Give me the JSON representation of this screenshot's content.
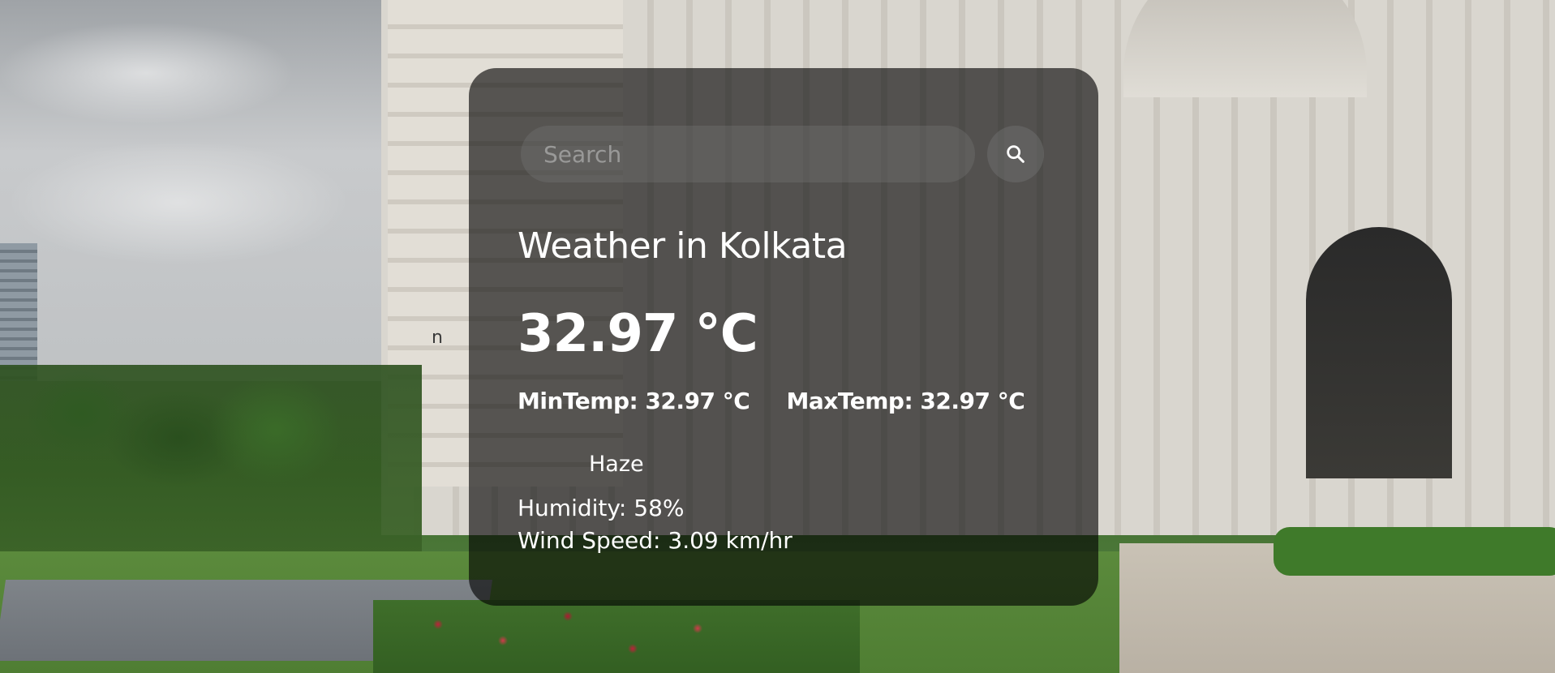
{
  "search": {
    "placeholder": "Search",
    "icon": "search-icon"
  },
  "weather": {
    "title": "Weather in Kolkata",
    "temperature": "32.97 °C",
    "min_temp": "MinTemp: 32.97 °C",
    "max_temp": "MaxTemp: 32.97 °C",
    "description": "Haze",
    "humidity": "Humidity: 58%",
    "wind_speed": "Wind Speed: 3.09 km/hr"
  },
  "stray_text": "n",
  "colors": {
    "card_background": "#000000",
    "text": "#ffffff"
  }
}
